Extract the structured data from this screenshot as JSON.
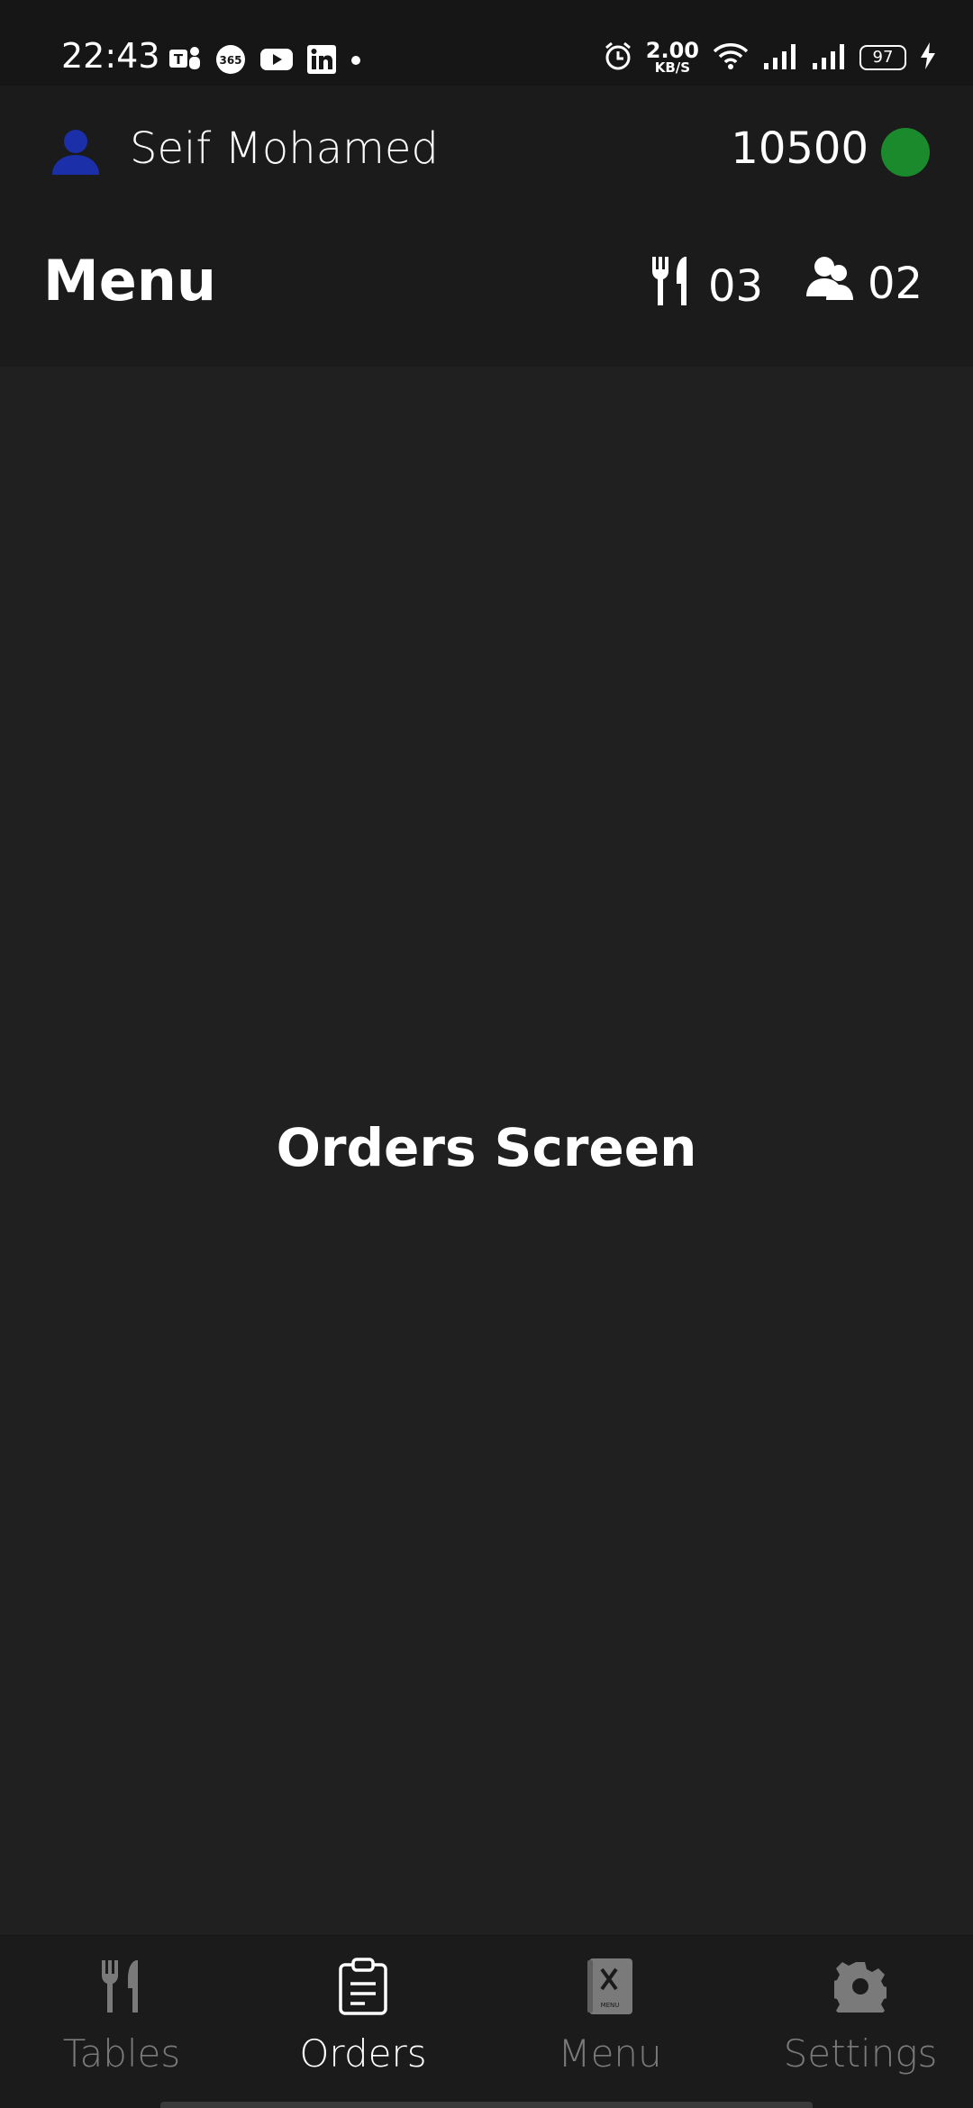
{
  "status_bar": {
    "time": "22:43",
    "net_speed_value": "2.00",
    "net_speed_unit": "KB/S",
    "battery": "97",
    "left_icons": [
      "teams-icon",
      "office365-icon",
      "youtube-icon",
      "linkedin-icon",
      "dot-icon"
    ],
    "right_icons": [
      "alarm-icon",
      "wifi-icon",
      "signal-icon",
      "signal-icon",
      "battery-icon",
      "charging-icon"
    ]
  },
  "header": {
    "user_name": "Seif Mohamed",
    "balance": "10500",
    "status_color": "#1a8a2d",
    "user_icon_color": "#1a2fa8",
    "title": "Menu",
    "tables_count": "03",
    "guests_count": "02"
  },
  "main": {
    "text": "Orders Screen"
  },
  "bottom_nav": {
    "items": [
      {
        "label": "Tables",
        "icon": "utensils-icon",
        "active": false
      },
      {
        "label": "Orders",
        "icon": "clipboard-icon",
        "active": true
      },
      {
        "label": "Menu",
        "icon": "menu-book-icon",
        "active": false
      },
      {
        "label": "Settings",
        "icon": "gear-icon",
        "active": false
      }
    ]
  },
  "colors": {
    "background": "#202020",
    "header": "#1b1b1b",
    "active": "#ffffff",
    "inactive": "#7a7a7a"
  }
}
